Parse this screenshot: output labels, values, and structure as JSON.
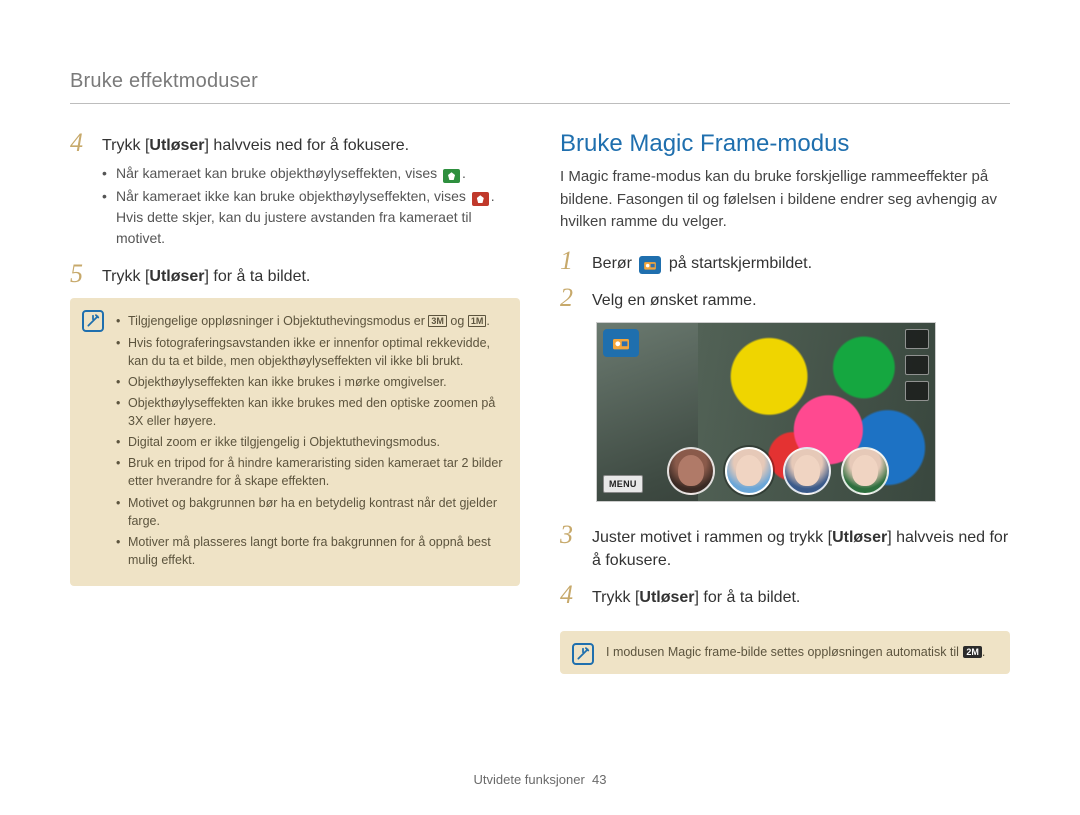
{
  "breadcrumb": "Bruke effektmoduser",
  "left": {
    "step4": {
      "num": "4",
      "text_pre": "Trykk [",
      "text_bold": "Utløser",
      "text_post": "] halvveis ned for å fokusere.",
      "bullets": [
        "Når kameraet kan bruke objekthøylyseffekten, vises",
        "Når kameraet ikke kan bruke objekthøylyseffekten, vises",
        "Hvis dette skjer, kan du justere avstanden fra kameraet til motivet."
      ]
    },
    "step5": {
      "num": "5",
      "text_pre": "Trykk [",
      "text_bold": "Utløser",
      "text_post": "] for å ta bildet."
    },
    "note_items": [
      "Tilgjengelige oppløsninger i Objektuthevingsmodus er",
      "Hvis fotograferingsavstanden ikke er innenfor optimal rekkevidde, kan du ta et bilde, men objekthøylyseffekten vil ikke bli brukt.",
      "Objekthøylyseffekten kan ikke brukes i mørke omgivelser.",
      "Objekthøylyseffekten kan ikke brukes med den optiske zoomen på 3X eller høyere.",
      "Digital zoom er ikke tilgjengelig i Objektuthevingsmodus.",
      "Bruk en tripod for å hindre kameraristing siden kameraet tar 2 bilder etter hverandre for å skape effekten.",
      "Motivet og bakgrunnen bør ha en betydelig kontrast når det gjelder farge.",
      "Motiver må plasseres langt borte fra bakgrunnen for å oppnå best mulig effekt."
    ],
    "note_glyphs": {
      "g1": "3M",
      "og": "og",
      "g2": "1M"
    }
  },
  "right": {
    "title": "Bruke Magic Frame-modus",
    "intro": "I Magic frame-modus kan du bruke forskjellige rammeeffekter på bildene. Fasongen til og følelsen i bildene endrer seg avhengig av hvilken ramme du velger.",
    "step1": {
      "num": "1",
      "pre": "Berør",
      "post": "på startskjermbildet."
    },
    "step2": {
      "num": "2",
      "text": "Velg en ønsket ramme."
    },
    "preview_menu": "MENU",
    "step3": {
      "num": "3",
      "pre": "Juster motivet i rammen og trykk [",
      "bold": "Utløser",
      "post": "] halvveis ned for å fokusere."
    },
    "step4": {
      "num": "4",
      "pre": "Trykk [",
      "bold": "Utløser",
      "post": "] for å ta bildet."
    },
    "note2_text": "I modusen Magic frame-bilde settes oppløsningen automatisk til",
    "note2_glyph": "2M"
  },
  "footer": {
    "label": "Utvidete funksjoner",
    "page": "43"
  }
}
